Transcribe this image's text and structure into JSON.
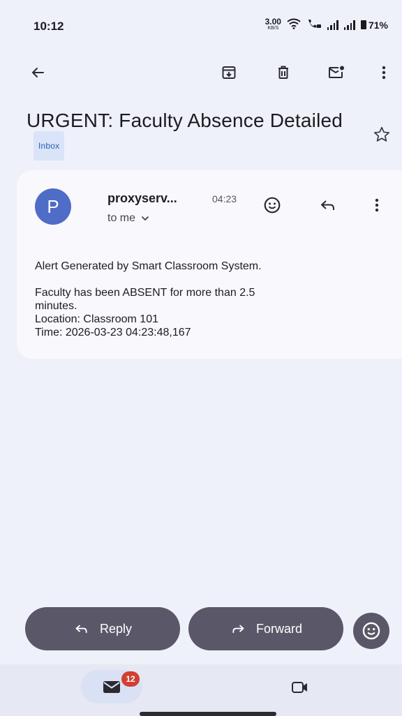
{
  "status_bar": {
    "time": "10:12",
    "speed_value": "3.00",
    "speed_unit": "KB/S",
    "battery": "71%"
  },
  "toolbar": {
    "icons": [
      "back-arrow-icon",
      "archive-icon",
      "delete-icon",
      "mark-unread-icon",
      "more-vert-icon"
    ]
  },
  "email": {
    "subject": "URGENT: Faculty Absence Detailed",
    "label": "Inbox",
    "sender": "proxyserv...",
    "time": "04:23",
    "recipient": "to me",
    "avatar_letter": "P",
    "avatar_color": "#4f6cc6",
    "body": {
      "line1": "Alert Generated by Smart Classroom System.",
      "line2": "Faculty has been ABSENT for more than 2.5",
      "line3": "minutes.",
      "line4": "Location: Classroom 101",
      "line5": "Time: 2026-03-23 04:23:48,167"
    }
  },
  "actions": {
    "reply_label": "Reply",
    "forward_label": "Forward"
  },
  "bottom_nav": {
    "mail_badge": "12",
    "badge_color": "#d23f31"
  }
}
